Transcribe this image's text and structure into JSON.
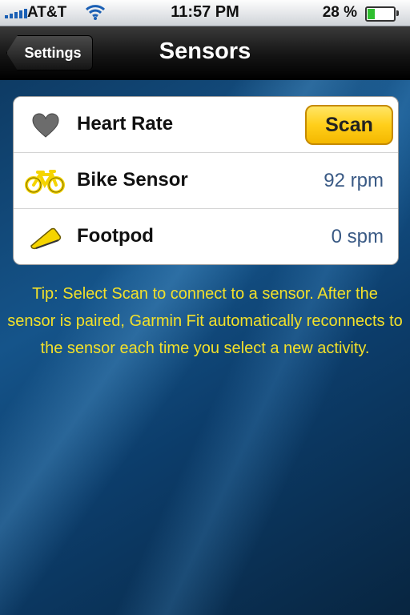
{
  "status_bar": {
    "carrier": "AT&T",
    "time": "11:57 PM",
    "battery": "28 %",
    "battery_level": 0.28,
    "icons": [
      "signal-bars-icon",
      "wifi-icon",
      "battery-icon"
    ]
  },
  "nav": {
    "back_label": "Settings",
    "title": "Sensors"
  },
  "sensors": [
    {
      "label": "Heart Rate",
      "icon": "heart-icon",
      "button": "Scan"
    },
    {
      "label": "Bike Sensor",
      "icon": "bike-icon",
      "value": "92 rpm"
    },
    {
      "label": "Footpod",
      "icon": "shoe-icon",
      "value": "0 spm"
    }
  ],
  "tip": "Tip: Select Scan to connect to a sensor. After the sensor is paired, Garmin Fit automatically reconnects to the sensor each time you select a new activity.",
  "colors": {
    "accent_yellow": "#ffd400",
    "tip_text": "#f2e02a",
    "value_text": "#3a5a85",
    "background": "#0f4575"
  }
}
